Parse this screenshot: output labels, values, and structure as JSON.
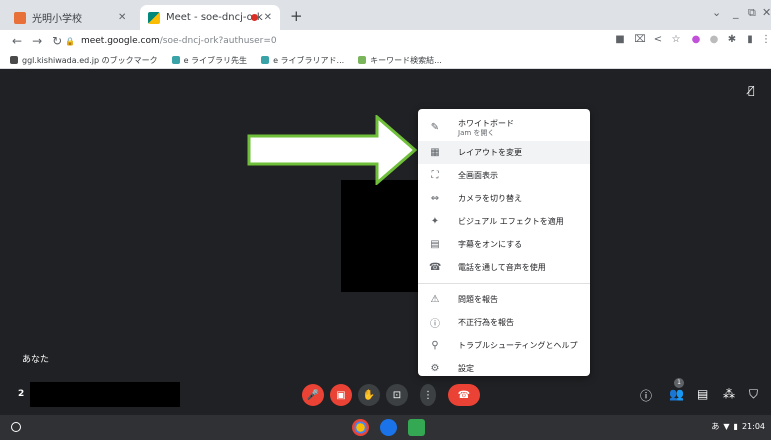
{
  "browser": {
    "tabs": [
      {
        "title": "光明小学校"
      },
      {
        "title": "Meet - soe-dncj-ork"
      }
    ],
    "new_tab": "+",
    "address": {
      "host": "meet.google.com",
      "path": "/soe-dncj-ork?authuser=0"
    },
    "bookmarks": [
      {
        "label": "ggl.kishiwada.ed.jp のブックマーク"
      },
      {
        "label": "e ライブラリ先生"
      },
      {
        "label": "e ライブラリアド..."
      },
      {
        "label": "キーワード検索結..."
      }
    ]
  },
  "meet": {
    "self_label": "あなた",
    "self_number": "2",
    "participants_count": "1",
    "menu": {
      "items": [
        {
          "label": "ホワイトボード",
          "sub": "Jam を開く",
          "icon": "pencil-icon"
        },
        {
          "label": "レイアウトを変更",
          "icon": "layout-icon"
        },
        {
          "label": "全画面表示",
          "icon": "fullscreen-icon"
        },
        {
          "label": "カメラを切り替え",
          "icon": "switch-camera-icon"
        },
        {
          "label": "ビジュアル エフェクトを適用",
          "icon": "sparkle-icon"
        },
        {
          "label": "字幕をオンにする",
          "icon": "captions-icon"
        },
        {
          "label": "電話を通して音声を使用",
          "icon": "phone-icon"
        },
        {
          "label": "問題を報告",
          "icon": "feedback-icon"
        },
        {
          "label": "不正行為を報告",
          "icon": "info-icon"
        },
        {
          "label": "トラブルシューティングとヘルプ",
          "icon": "help-search-icon"
        },
        {
          "label": "設定",
          "icon": "gear-icon"
        }
      ]
    }
  },
  "system": {
    "ime": "あ",
    "time": "21:04"
  },
  "colors": {
    "accent_red": "#ea4335",
    "stage_bg": "#202124",
    "arrow_green": "#6fbf3a"
  }
}
